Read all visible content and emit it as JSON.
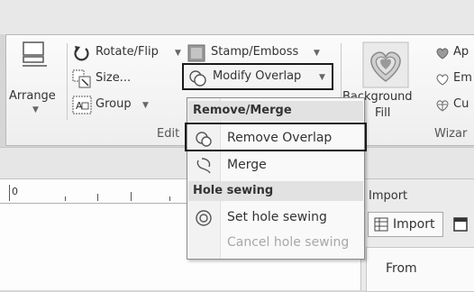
{
  "ribbon": {
    "arrange_label": "Arrange",
    "rotate_flip_label": "Rotate/Flip",
    "stamp_emboss_label": "Stamp/Emboss",
    "size_label": "Size...",
    "modify_overlap_label": "Modify Overlap",
    "group_label": "Group",
    "edit_group_label": "Edit",
    "background_label_1": "Background",
    "background_label_2": "Fill",
    "wizard_group_label": "Wizar",
    "wizard_item_1": "Ap",
    "wizard_item_2": "Em",
    "wizard_item_3": "Cu"
  },
  "menu": {
    "header_remove_merge": "Remove/Merge",
    "item_remove_overlap": "Remove Overlap",
    "item_merge": "Merge",
    "header_hole_sewing": "Hole sewing",
    "item_set_hole_sewing": "Set hole sewing",
    "item_cancel_hole_sewing": "Cancel hole sewing"
  },
  "ruler": {
    "zero": "0"
  },
  "import_panel": {
    "title": "Import",
    "tab_label": "Import",
    "from_label": "From"
  },
  "colors": {
    "highlight_border": "#1a1a1a",
    "menu_header_bg": "#e2e2e2"
  }
}
